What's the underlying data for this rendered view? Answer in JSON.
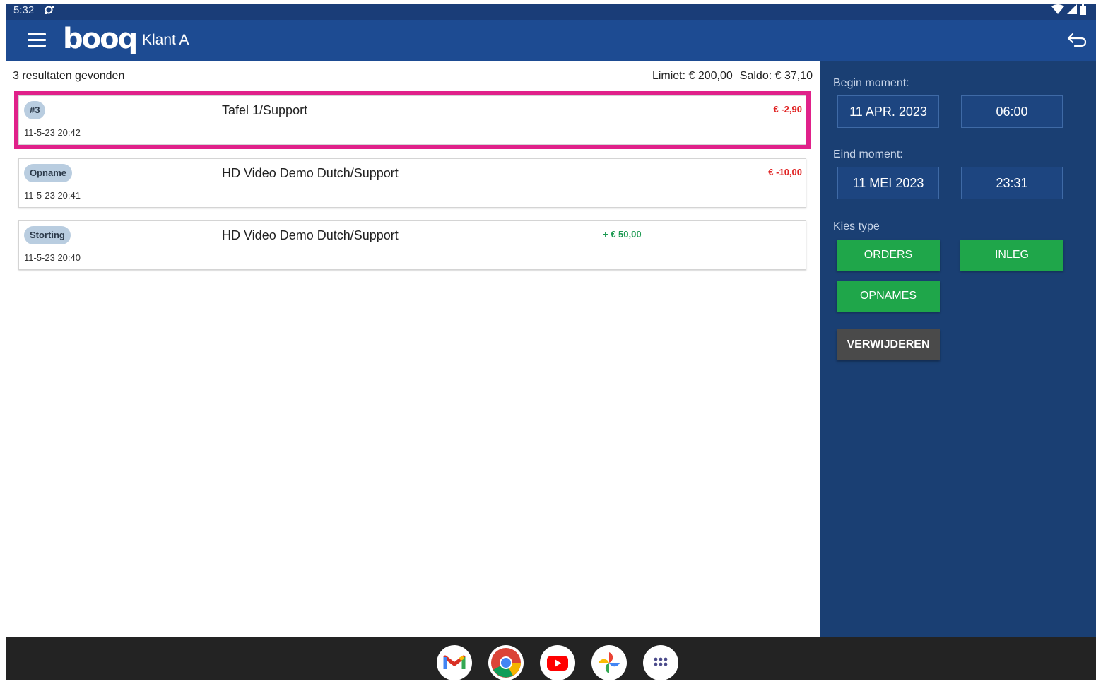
{
  "status_bar": {
    "time": "5:32"
  },
  "app_bar": {
    "logo": "booq",
    "title": "Klant A"
  },
  "results": {
    "count_text": "3 resultaten gevonden",
    "limit_text": "Limiet: € 200,00",
    "saldo_text": "Saldo: € 37,10"
  },
  "transactions": [
    {
      "badge": "#3",
      "date": "11-5-23 20:42",
      "description": "Tafel 1/Support",
      "amount": "€ -2,90",
      "type": "negative",
      "selected": true
    },
    {
      "badge": "Opname",
      "date": "11-5-23 20:41",
      "description": "HD Video Demo Dutch/Support",
      "amount": "€ -10,00",
      "type": "negative",
      "selected": false
    },
    {
      "badge": "Storting",
      "date": "11-5-23 20:40",
      "description": "HD Video Demo Dutch/Support",
      "amount": "+ € 50,00",
      "type": "positive",
      "selected": false
    }
  ],
  "filter_panel": {
    "begin_label": "Begin moment:",
    "begin_date": "11 APR. 2023",
    "begin_time": "06:00",
    "end_label": "Eind moment:",
    "end_date": "11 MEI 2023",
    "end_time": "23:31",
    "type_label": "Kies type",
    "orders_label": "ORDERS",
    "inleg_label": "INLEG",
    "opnames_label": "OPNAMES",
    "delete_label": "VERWIJDEREN"
  },
  "dock": {
    "apps": [
      "gmail-icon",
      "chrome-icon",
      "youtube-icon",
      "photos-icon",
      "app-drawer-icon"
    ]
  },
  "colors": {
    "app_bar": "#1d4b92",
    "panel": "#1a3f73",
    "accent_green": "#1fa64a",
    "negative_amount": "#e02424",
    "positive_amount": "#1d9a52",
    "selection_highlight": "#e0218a"
  }
}
